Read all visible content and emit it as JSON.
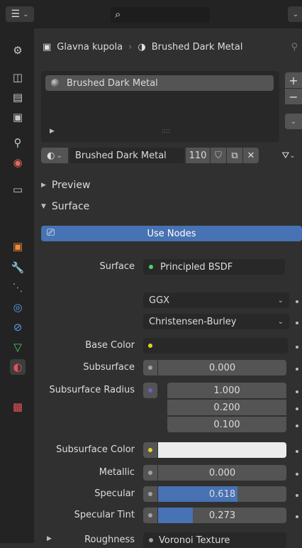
{
  "header": {
    "search_placeholder": "",
    "breadcrumb_object": "Glavna kupola",
    "breadcrumb_material": "Brushed Dark Metal"
  },
  "material_slots": {
    "items": [
      {
        "label": "Brushed Dark Metal"
      }
    ]
  },
  "datablock": {
    "name": "Brushed Dark Metal",
    "users": "110"
  },
  "panels": {
    "preview": "Preview",
    "surface": "Surface"
  },
  "use_nodes": "Use Nodes",
  "properties": {
    "surface_label": "Surface",
    "surface_value": "Principled BSDF",
    "distribution": "GGX",
    "subsurface_method": "Christensen-Burley",
    "base_color_label": "Base Color",
    "subsurface_label": "Subsurface",
    "subsurface_value": "0.000",
    "subsurface_radius_label": "Subsurface Radius",
    "subsurface_radius": [
      "1.000",
      "0.200",
      "0.100"
    ],
    "subsurface_color_label": "Subsurface Color",
    "metallic_label": "Metallic",
    "metallic_value": "0.000",
    "specular_label": "Specular",
    "specular_value": "0.618",
    "specular_fraction": 0.618,
    "specular_tint_label": "Specular Tint",
    "specular_tint_value": "0.273",
    "specular_tint_fraction": 0.273,
    "roughness_label": "Roughness",
    "roughness_value": "Voronoi Texture"
  },
  "colors": {
    "accent_blue": "#4772b3",
    "green_socket": "#4ad36b",
    "yellow_socket": "#e5d12a",
    "purple_socket": "#6363c7",
    "grey_socket": "#a1a1a1"
  }
}
